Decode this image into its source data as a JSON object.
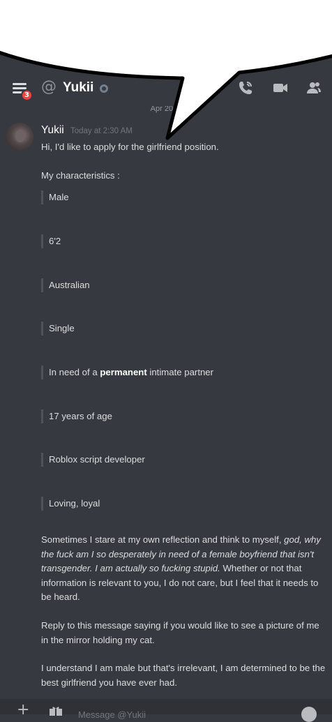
{
  "header": {
    "badge_count": "3",
    "title": "Yukii"
  },
  "date_divider": "Apr 20, 2",
  "message": {
    "username": "Yukii",
    "timestamp": "Today at 2:30 AM",
    "intro": "Hi, I'd like to apply for the girlfriend position.",
    "characteristics_heading": "My characteristics :",
    "characteristics": [
      {
        "text": "Male"
      },
      {
        "text": "6'2"
      },
      {
        "text": "Australian"
      },
      {
        "text": "Single"
      },
      {
        "before": "In need of a ",
        "bold": "permanent",
        "after": " intimate partner"
      },
      {
        "text": "17 years of age"
      },
      {
        "text": "Roblox script developer"
      },
      {
        "text": "Loving, loyal"
      }
    ],
    "paragraph1": {
      "start": "Sometimes I stare at my own reflection and think to myself, ",
      "italic": "god, why the fuck am I so desperately in need of a female boyfriend that isn't transgender. I am actually so fucking stupid.",
      "end": " Whether or not that information is relevant to you, I do not care, but I feel that it needs to be heard."
    },
    "paragraph2": "Reply to this message saying if you would like to see a picture of me in the mirror holding my cat.",
    "paragraph3": "I understand I am male but that's irrelevant, I am determined to be the best girlfriend you have ever had."
  },
  "composer": {
    "plus": "+",
    "placeholder": "Message @Yukii"
  },
  "icons": [
    "menu-icon",
    "at-icon",
    "call-icon",
    "video-icon",
    "members-icon",
    "plus-icon",
    "gift-icon",
    "emoji-icon"
  ],
  "colors": {
    "background": "#36393f",
    "text": "#dcddde",
    "username": "#ffffff",
    "timestamp": "#72767d",
    "badge": "#ed4245",
    "quote_bar": "#4f545c"
  }
}
